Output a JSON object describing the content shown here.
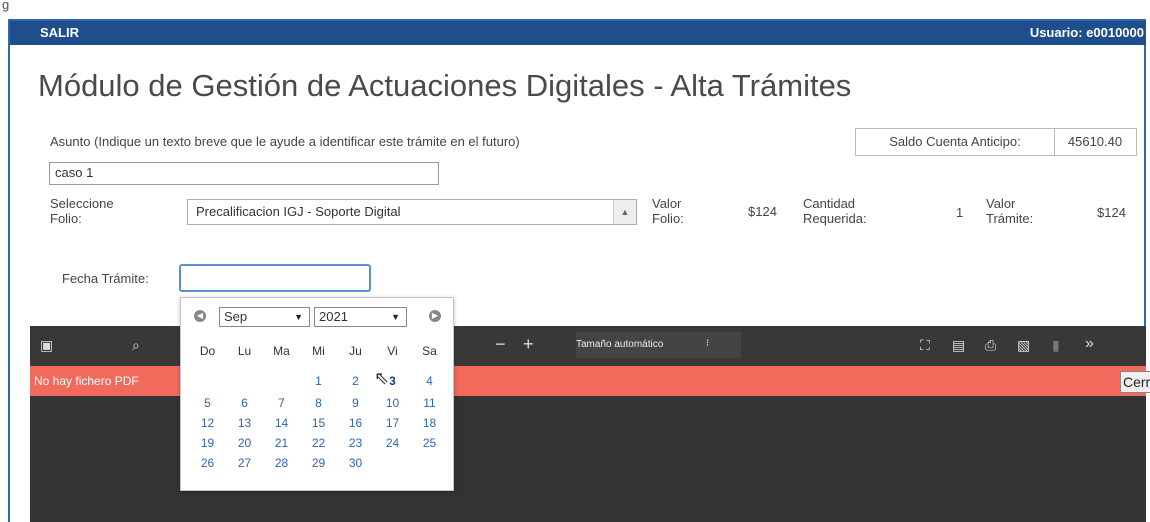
{
  "frame_label": "g",
  "topbar": {
    "salir": "SALIR",
    "usuario": "Usuario: e0010000"
  },
  "title": "Módulo de Gestión de Actuaciones Digitales - Alta Trámites",
  "asunto": {
    "label": "Asunto (Indique un texto breve que le ayude a identificar este trámite en el futuro)",
    "value": "caso 1"
  },
  "saldo": {
    "label": "Saldo Cuenta Anticipo:",
    "value": "45610.40"
  },
  "folio": {
    "label_line1": "Seleccione",
    "label_line2": "Folio:",
    "selected": "Precalificacion IGJ - Soporte Digital",
    "valor_folio_l1": "Valor",
    "valor_folio_l2": "Folio:",
    "valor_folio_value": "$124",
    "cantidad_l1": "Cantidad",
    "cantidad_l2": "Requerida:",
    "cantidad_value": "1",
    "valor_tramite_l1": "Valor",
    "valor_tramite_l2": "Trámite:",
    "valor_tramite_value": "$124"
  },
  "fecha": {
    "label": "Fecha Trámite:",
    "value": ""
  },
  "calendar": {
    "month": "Sep",
    "year": "2021",
    "weekdays": [
      "Do",
      "Lu",
      "Ma",
      "Mi",
      "Ju",
      "Vi",
      "Sa"
    ],
    "weeks": [
      [
        "",
        "",
        "",
        "1",
        "2",
        "3",
        "4"
      ],
      [
        "5",
        "6",
        "7",
        "8",
        "9",
        "10",
        "11"
      ],
      [
        "12",
        "13",
        "14",
        "15",
        "16",
        "17",
        "18"
      ],
      [
        "19",
        "20",
        "21",
        "22",
        "23",
        "24",
        "25"
      ],
      [
        "26",
        "27",
        "28",
        "29",
        "30",
        "",
        ""
      ]
    ]
  },
  "pdf": {
    "zoom": "Tamaño automático",
    "banner": "No hay fichero PDF",
    "cerrar": "Cerrar"
  },
  "colors": {
    "topbar": "#1f4e8c",
    "banner": "#f26a5b",
    "viewer": "#333333",
    "border": "#2e67b4"
  }
}
